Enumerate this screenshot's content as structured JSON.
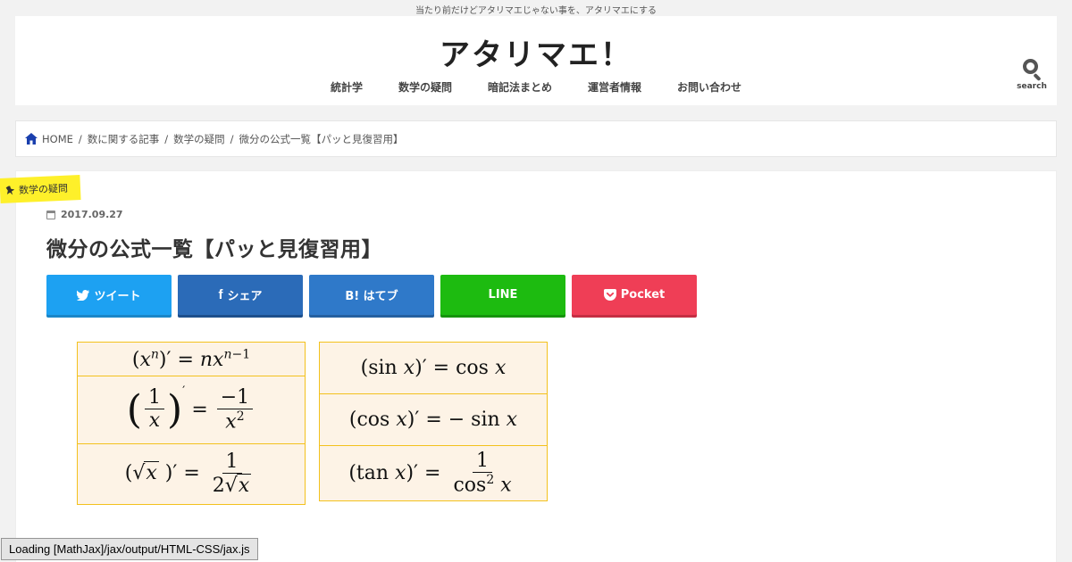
{
  "header": {
    "tagline": "当たり前だけどアタリマエじゃない事を、アタリマエにする",
    "site_title": "アタリマエ！",
    "nav": [
      "統計学",
      "数学の疑問",
      "暗記法まとめ",
      "運営者情報",
      "お問い合わせ"
    ],
    "search_label": "search",
    "search_icon": "search-icon"
  },
  "breadcrumb": {
    "home": "HOME",
    "items": [
      "数に関する記事",
      "数学の疑問",
      "微分の公式一覧【パッと見復習用】"
    ],
    "separator": "/",
    "home_icon": "home-icon"
  },
  "article": {
    "category": "数学の疑問",
    "category_color": "#fef02a",
    "date": "2017.09.27",
    "title": "微分の公式一覧【パッと見復習用】"
  },
  "share_buttons": [
    {
      "label": "ツイート",
      "icon": "twitter-icon",
      "color": "#1da1f2"
    },
    {
      "label": "シェア",
      "icon": "facebook-icon",
      "color": "#2b6bb8"
    },
    {
      "label": "B! はてブ",
      "icon": "hatena-icon",
      "color": "#2f79c9"
    },
    {
      "label": "LINE",
      "icon": "line-icon",
      "color": "#1dbb10"
    },
    {
      "label": "Pocket",
      "icon": "pocket-icon",
      "color": "#ef3e56"
    }
  ],
  "formulas": {
    "left": [
      "(x^n)′ = nx^(n−1)",
      "(1/x)′ = −1/x²",
      "(√x)′ = 1/(2√x)"
    ],
    "right": [
      "(sin x)′ = cos x",
      "(cos x)′ = − sin x",
      "(tan x)′ = 1/cos² x"
    ]
  },
  "status_bar": "Loading [MathJax]/jax/output/HTML-CSS/jax.js"
}
